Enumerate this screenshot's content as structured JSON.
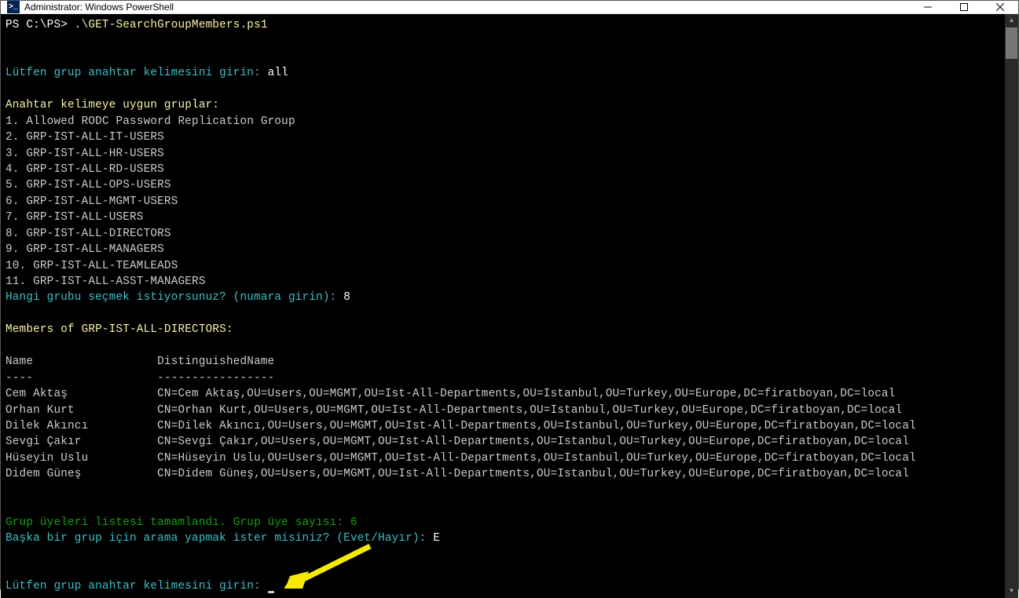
{
  "window": {
    "title": "Administrator: Windows PowerShell"
  },
  "prompt": {
    "ps": "PS C:\\PS>",
    "command": ".\\GET-SearchGroupMembers.ps1"
  },
  "input_keyword": {
    "label": "Lütfen grup anahtar kelimesini girin:",
    "value": "all"
  },
  "groups_header": "Anahtar kelimeye uygun gruplar:",
  "groups": [
    "1. Allowed RODC Password Replication Group",
    "2. GRP-IST-ALL-IT-USERS",
    "3. GRP-IST-ALL-HR-USERS",
    "4. GRP-IST-ALL-RD-USERS",
    "5. GRP-IST-ALL-OPS-USERS",
    "6. GRP-IST-ALL-MGMT-USERS",
    "7. GRP-IST-ALL-USERS",
    "8. GRP-IST-ALL-DIRECTORS",
    "9. GRP-IST-ALL-MANAGERS",
    "10. GRP-IST-ALL-TEAMLEADS",
    "11. GRP-IST-ALL-ASST-MANAGERS"
  ],
  "select_group": {
    "label": "Hangi grubu seçmek istiyorsunuz? (numara girin):",
    "value": "8"
  },
  "members_header": "Members of GRP-IST-ALL-DIRECTORS:",
  "table": {
    "col1": "Name",
    "col2": "DistinguishedName",
    "div1": "----",
    "div2": "-----------------",
    "rows": [
      {
        "name": "Cem Aktaş",
        "dn": "CN=Cem Aktaş,OU=Users,OU=MGMT,OU=Ist-All-Departments,OU=Istanbul,OU=Turkey,OU=Europe,DC=firatboyan,DC=local"
      },
      {
        "name": "Orhan Kurt",
        "dn": "CN=Orhan Kurt,OU=Users,OU=MGMT,OU=Ist-All-Departments,OU=Istanbul,OU=Turkey,OU=Europe,DC=firatboyan,DC=local"
      },
      {
        "name": "Dilek Akıncı",
        "dn": "CN=Dilek Akıncı,OU=Users,OU=MGMT,OU=Ist-All-Departments,OU=Istanbul,OU=Turkey,OU=Europe,DC=firatboyan,DC=local"
      },
      {
        "name": "Sevgi Çakır",
        "dn": "CN=Sevgi Çakır,OU=Users,OU=MGMT,OU=Ist-All-Departments,OU=Istanbul,OU=Turkey,OU=Europe,DC=firatboyan,DC=local"
      },
      {
        "name": "Hüseyin Uslu",
        "dn": "CN=Hüseyin Uslu,OU=Users,OU=MGMT,OU=Ist-All-Departments,OU=Istanbul,OU=Turkey,OU=Europe,DC=firatboyan,DC=local"
      },
      {
        "name": "Didem Güneş",
        "dn": "CN=Didem Güneş,OU=Users,OU=MGMT,OU=Ist-All-Departments,OU=Istanbul,OU=Turkey,OU=Europe,DC=firatboyan,DC=local"
      }
    ]
  },
  "completed": "Grup üyeleri listesi tamamlandı. Grup üye sayısı: 6",
  "another": {
    "label": "Başka bir grup için arama yapmak ister misiniz? (Evet/Hayır):",
    "value": "E"
  },
  "input_keyword2": {
    "label": "Lütfen grup anahtar kelimesini girin:"
  }
}
